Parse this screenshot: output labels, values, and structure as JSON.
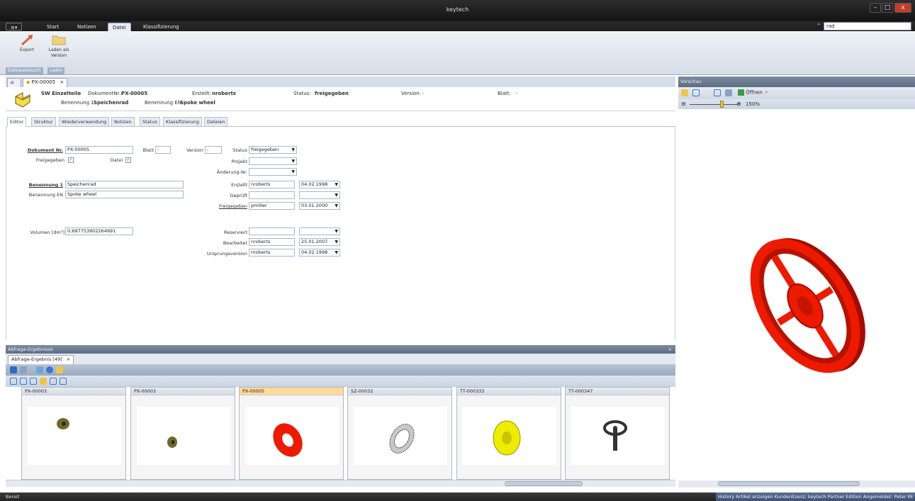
{
  "app": {
    "title": "keytech"
  },
  "ribbon": {
    "tabs": [
      {
        "label": "Start"
      },
      {
        "label": "Notizen"
      },
      {
        "label": "Datei"
      },
      {
        "label": "Klassifizierung"
      }
    ],
    "buttons": {
      "export": "Export",
      "load_as_version": "Laden als Version"
    },
    "groups": {
      "exchange": "Dateiaustausch",
      "load": "Laden"
    },
    "search_value": "rad"
  },
  "doc_tab": {
    "label": "PX-00005"
  },
  "header": {
    "type": "SW Einzelteile",
    "docnr_label": "DokumentNr.:",
    "docnr": "PX-00005",
    "created_label": "Erstellt:",
    "created": "nroberts",
    "status_label": "Status:",
    "status": "freigegeben",
    "version_label": "Version:",
    "version": "-",
    "sheet_label": "Blatt:",
    "sheet": "-",
    "name1_label": "Benennung 1:",
    "name1": "Speichenrad",
    "name_en_label": "Benennung EN:",
    "name_en": "Spoke wheel"
  },
  "subtabs": [
    "Editor",
    "Struktur",
    "Wiederverwendung",
    "Notizen",
    "Status",
    "Klassifizierung",
    "Dateien"
  ],
  "form": {
    "docnr_label": "Dokument Nr.",
    "docnr": "PX-00005",
    "blatt_label": "Blatt",
    "blatt": "-",
    "version_label": "Version",
    "version": "-",
    "status_label": "Status",
    "status": "freigegeben",
    "freigegeben_label": "Freigegeben",
    "datei_label": "Datei",
    "projekt_label": "Projekt",
    "aenderung_label": "Änderung-Nr.",
    "name1_label": "Benennung 1",
    "name1": "Speichenrad",
    "name_en_label": "Benennung EN",
    "name_en": "Spoke wheel",
    "erstellt_label": "Erstellt",
    "erstellt_user": "nroberts",
    "erstellt_date": "04.02.1998",
    "geprueft_label": "Geprüft",
    "freigegeben2_label": "Freigegeben",
    "freigegeben_user": "pmiller",
    "freigegeben_date": "03.01.2000",
    "volumen_label": "Volumen [dm³]",
    "volumen": "0,697753902264991",
    "reserviert_label": "Reserviert",
    "bearbeitet_label": "Bearbeitet",
    "bearbeitet_user": "nroberts",
    "bearbeitet_date": "25.01.2007",
    "ursprung_label": "Ursprungsversion",
    "ursprung_user": "nroberts",
    "ursprung_date": "04.02.1998"
  },
  "results": {
    "header": "Abfrage-Ergebnisse",
    "tab": "Abfrage-Ergebnis [49]",
    "items": [
      {
        "label": "PX-00003"
      },
      {
        "label": "PX-00003"
      },
      {
        "label": "PX-00005"
      },
      {
        "label": "SZ-00032"
      },
      {
        "label": "TT-000333"
      },
      {
        "label": "TT-000347"
      }
    ]
  },
  "preview": {
    "header": "Vorschau",
    "open_label": "Öffnen",
    "zoom": "150%"
  },
  "status": {
    "left": "Bereit",
    "right": "History Artikel anzeigen   Kundenlizenz: keytech Partner Edition   Angemeldet: Peter Mi"
  },
  "colors": {
    "accent": "#ffd998",
    "part_red": "#ee1a00",
    "part_yellow": "#f0ec00"
  }
}
